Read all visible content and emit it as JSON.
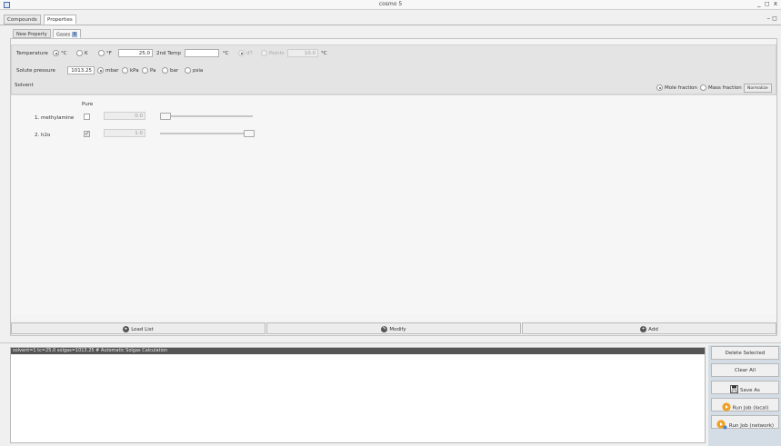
{
  "window": {
    "title": "cosmo 5",
    "controls": "_ ◻ x",
    "app_icon": "window-icon"
  },
  "top_tabs": [
    {
      "label": "Compounds",
      "active": false
    },
    {
      "label": "Properties",
      "active": true
    }
  ],
  "top_tab_controls": "– ◻",
  "sub_tabs": [
    {
      "label": "New Property",
      "active": false
    },
    {
      "label": "Gases",
      "active": true,
      "close_label": "X"
    }
  ],
  "params": {
    "temperature_label": "Temperature",
    "temp_units": [
      "°C",
      "K",
      "°F"
    ],
    "temp_unit_selected": "°C",
    "temp_value": "25.0",
    "second_temp_label": "2nd Temp",
    "second_temp_value": "",
    "second_temp_unit": "°C",
    "dt_label": "dT",
    "points_label": "Points",
    "points_value": "10.0",
    "points_unit": "°C",
    "solute_pressure_label": "Solute pressure",
    "solute_pressure_value": "1013.25",
    "pressure_units": [
      "mbar",
      "kPa",
      "Pa",
      "bar",
      "psia"
    ],
    "pressure_unit_selected": "mbar",
    "solvent_label": "Solvent",
    "fraction_options": [
      "Mole fraction",
      "Mass fraction"
    ],
    "fraction_selected": "Mole fraction",
    "normalize_label": "Normalize"
  },
  "compounds": {
    "pure_header": "Pure",
    "rows": [
      {
        "label": "1.  methylamine",
        "pure": false,
        "value": "0.0",
        "slider_fraction": 0.0
      },
      {
        "label": "2.  h2o",
        "pure": true,
        "value": "1.0",
        "slider_fraction": 1.0
      }
    ]
  },
  "actions": {
    "load_list": "Load List",
    "modify": "Modify",
    "add": "Add"
  },
  "log": {
    "line": "solvent=1 tc=25.0 solgas=1013.25 # Automatic Solgas Calculation"
  },
  "side_buttons": {
    "delete_selected": "Delete Selected",
    "clear_all": "Clear All",
    "save_as": "Save As",
    "run_local": "Run Job (local)",
    "run_network": "Run Job (network)"
  },
  "colors": {
    "accent": "#f0a020",
    "log_header_bg": "#555555",
    "right_panel_bg": "#d4dde5"
  }
}
